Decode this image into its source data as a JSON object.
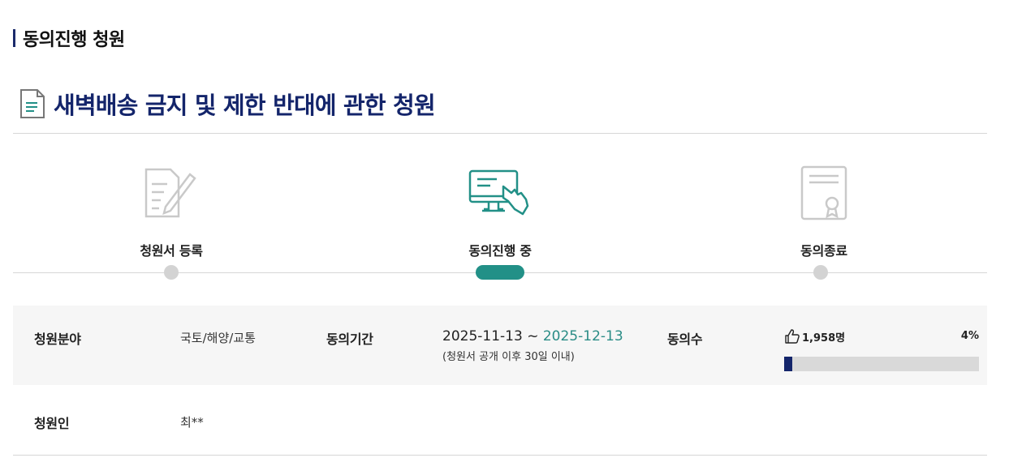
{
  "section_title": "동의진행 청원",
  "petition_title": "새벽배송 금지 및 제한 반대에 관한 청원",
  "steps": [
    {
      "label": "청원서 등록",
      "icon": "document-pen-icon",
      "state": "done"
    },
    {
      "label": "동의진행 중",
      "icon": "monitor-hand-icon",
      "state": "current"
    },
    {
      "label": "동의종료",
      "icon": "certificate-icon",
      "state": "pending"
    }
  ],
  "info": {
    "field_label": "청원분야",
    "field_value": "국토/해양/교통",
    "period_label": "동의기간",
    "period_start": "2025-11-13",
    "period_sep": " ~ ",
    "period_end": "2025-12-13",
    "period_note": "(청원서 공개 이후 30일 이내)",
    "agree_label": "동의수",
    "agree_count": "1,958명",
    "agree_percent": "4%",
    "agree_fraction": 0.04,
    "petitioner_label": "청원인",
    "petitioner_value": "최**"
  },
  "colors": {
    "navy": "#14256b",
    "teal": "#229087",
    "gray_dot": "#d3d3d3"
  }
}
